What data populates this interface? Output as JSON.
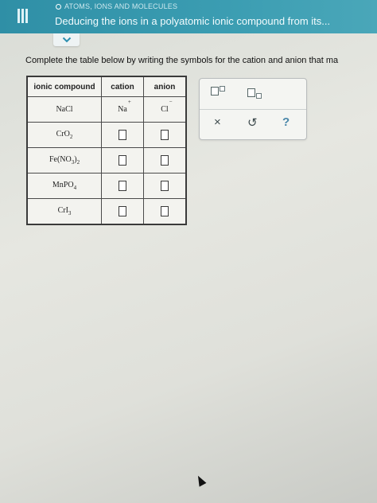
{
  "header": {
    "breadcrumb": "ATOMS, IONS AND MOLECULES",
    "title": "Deducing the ions in a polyatomic ionic compound from its..."
  },
  "instructions": "Complete the table below by writing the symbols for the cation and anion that ma",
  "table": {
    "headers": [
      "ionic compound",
      "cation",
      "anion"
    ],
    "rows": [
      {
        "compound": "NaCl",
        "cation": "Na",
        "cation_charge": "+",
        "anion": "Cl",
        "anion_charge": "−"
      },
      {
        "compound": "CrO",
        "compound_sub": "2"
      },
      {
        "compound": "Fe(NO",
        "compound_sub": "3",
        "compound_tail": ")",
        "compound_sub2": "2"
      },
      {
        "compound": "MnPO",
        "compound_sub": "4"
      },
      {
        "compound": "CrI",
        "compound_sub": "3"
      }
    ]
  },
  "toolbar": {
    "superscript_icon": "superscript-box-icon",
    "subscript_icon": "subscript-box-icon",
    "clear_label": "×",
    "undo_label": "↺",
    "help_label": "?"
  },
  "colors": {
    "header_bg": "#3b9db2",
    "help": "#4a87a9"
  }
}
